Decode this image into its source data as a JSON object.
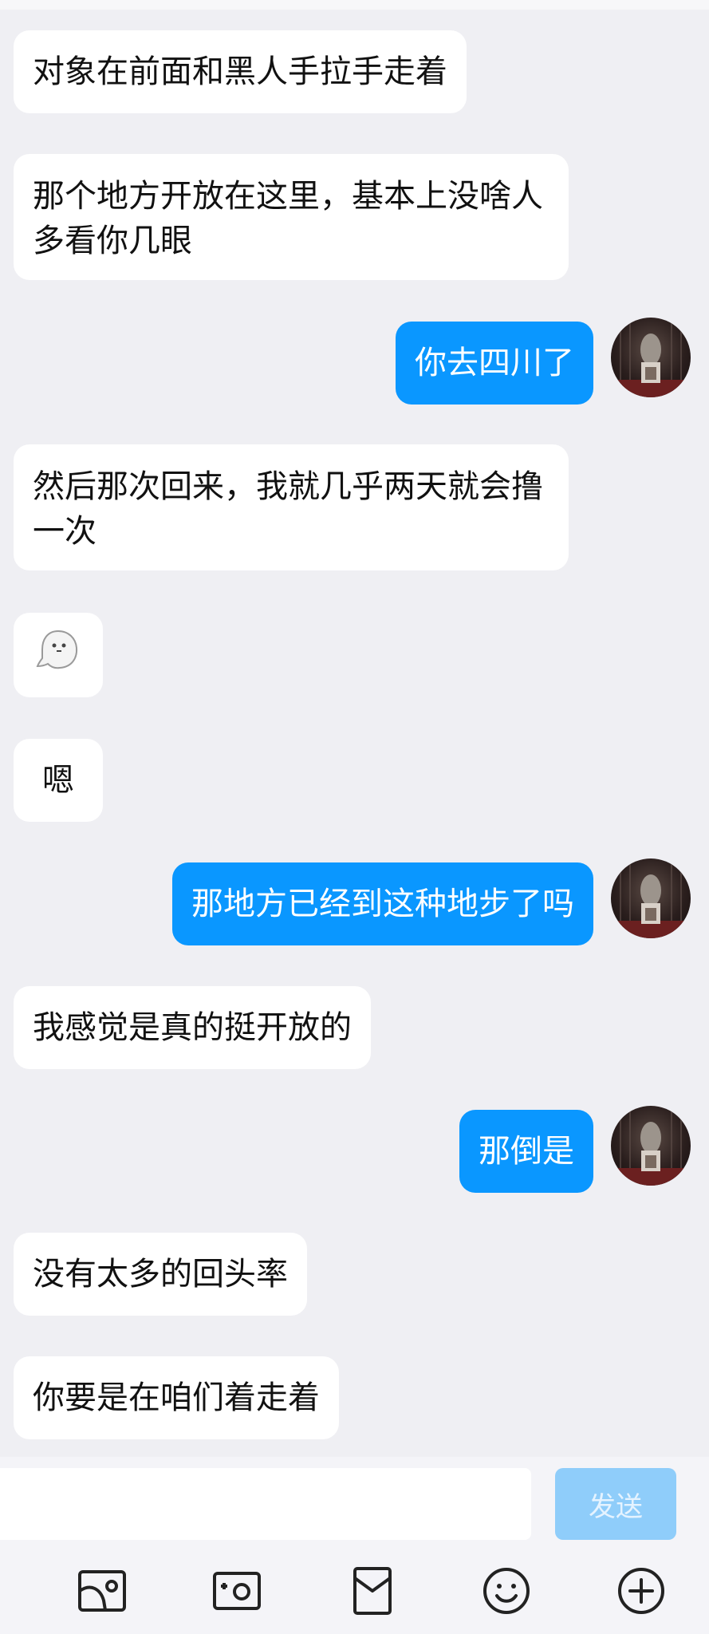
{
  "messages": [
    {
      "side": "in",
      "text": "对象在前面和黑人手拉手走着"
    },
    {
      "side": "in",
      "text": "那个地方开放在这里，基本上没啥人多看你几眼"
    },
    {
      "side": "out",
      "text": "你去四川了"
    },
    {
      "side": "in",
      "text": "然后那次回来，我就几乎两天就会撸一次"
    },
    {
      "side": "in",
      "emoji": "ghost-emoji"
    },
    {
      "side": "in",
      "text": "嗯"
    },
    {
      "side": "out",
      "text": "那地方已经到这种地步了吗"
    },
    {
      "side": "in",
      "text": "我感觉是真的挺开放的"
    },
    {
      "side": "out",
      "text": "那倒是"
    },
    {
      "side": "in",
      "text": "没有太多的回头率"
    },
    {
      "side": "in",
      "text": "你要是在咱们着走着"
    }
  ],
  "composer": {
    "input_value": "",
    "send_label": "发送"
  },
  "toolbar": {
    "icons": [
      "image-icon",
      "camera-icon",
      "red-packet-icon",
      "emoji-icon",
      "plus-icon"
    ]
  },
  "colors": {
    "background": "#efeff3",
    "incoming_bubble": "#ffffff",
    "outgoing_bubble": "#0a97ff",
    "send_disabled": "#8fcdfa"
  }
}
